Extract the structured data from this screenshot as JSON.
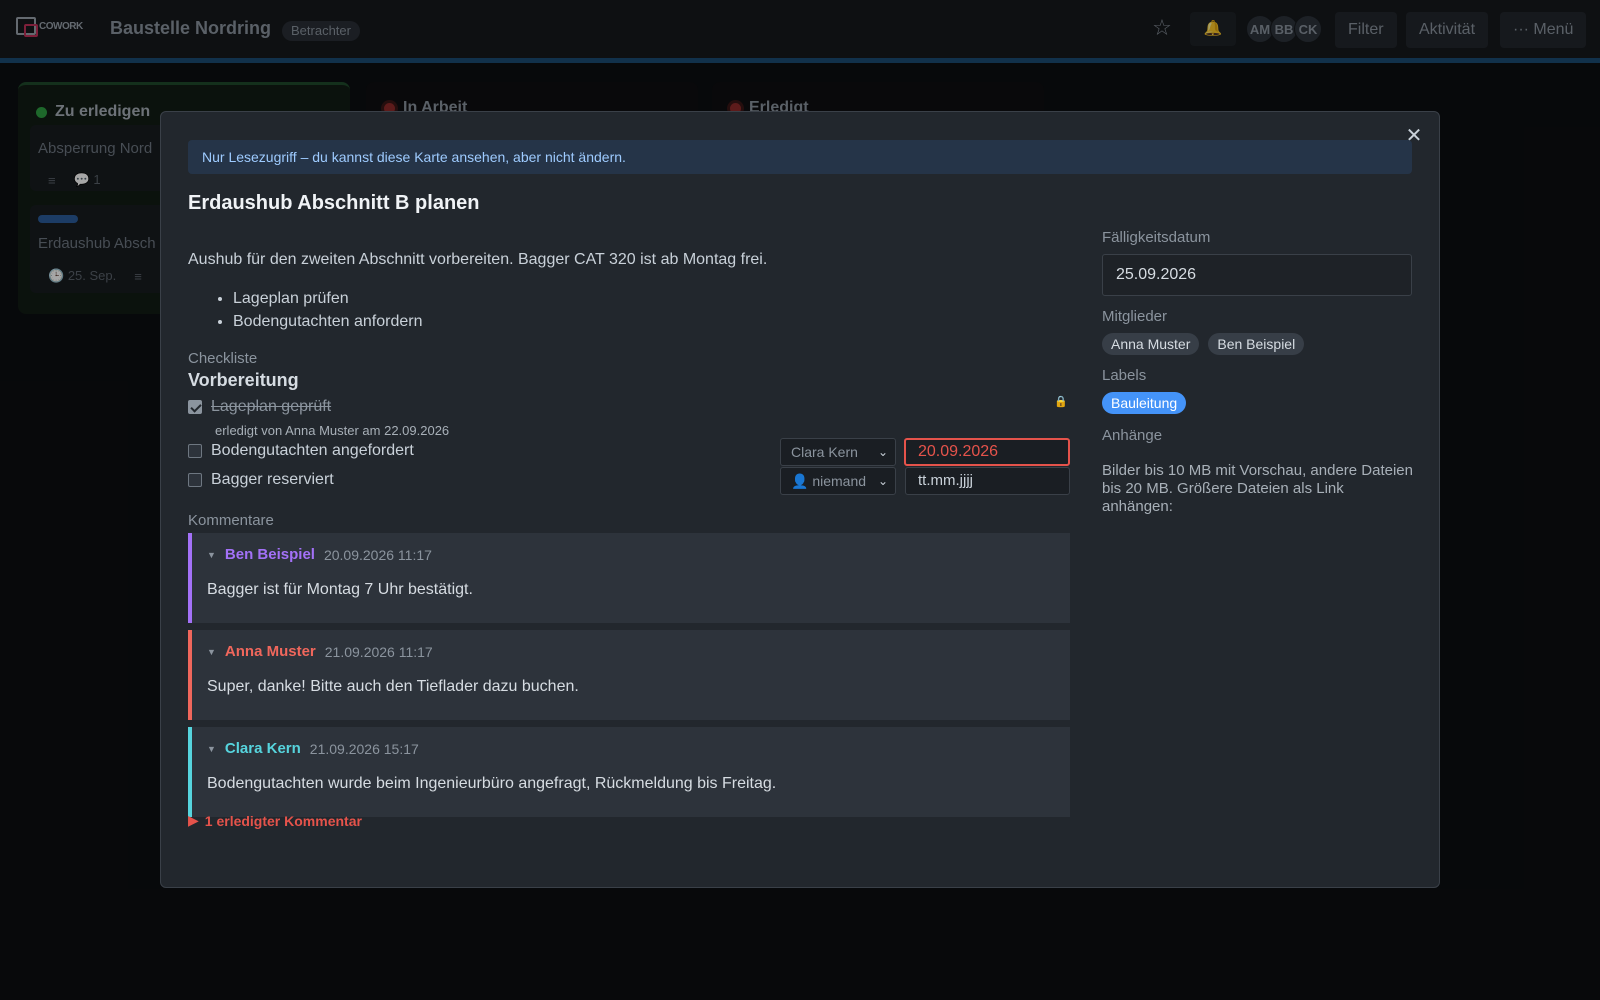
{
  "topbar": {
    "logo_text_a": "COWORK",
    "logo_text_b": "",
    "board_title": "Baustelle Nordring",
    "role_badge": "Betrachter",
    "avatars": [
      "AM",
      "BB",
      "CK"
    ],
    "filter_label": "Filter",
    "activity_label": "Aktivität",
    "menu_label": "··· Menü"
  },
  "columns": [
    {
      "title": "Zu erledigen",
      "status_color": "#2ea043"
    },
    {
      "title": "In Arbeit",
      "status_color": "#8f2a2a"
    },
    {
      "title": "Erledigt",
      "status_color": "#8f2a2a"
    }
  ],
  "mini_cards": [
    {
      "title": "Absperrung Nord",
      "comments": "1"
    },
    {
      "title": "Erdaushub Absch",
      "label_color": "#2b5d9c",
      "due": "25. Sep."
    }
  ],
  "modal": {
    "readonly_note": "Nur Lesezugriff – du kannst diese Karte ansehen, aber nicht ändern.",
    "title": "Erdaushub Abschnitt B planen",
    "description": "Aushub für den zweiten Abschnitt vorbereiten. Bagger CAT 320 ist ab Montag frei.",
    "bullets": [
      "Lageplan prüfen",
      "Bodengutachten anfordern"
    ],
    "checklist_label": "Checkliste",
    "checklist_title": "Vorbereitung",
    "checklist": [
      {
        "text": "Lageplan geprüft",
        "checked": true,
        "done_by": "erledigt von Anna Muster am 22.09.2026"
      },
      {
        "text": "Bodengutachten angefordert",
        "checked": false,
        "assignee": "Clara Kern",
        "due": "20.09.2026"
      },
      {
        "text": "Bagger reserviert",
        "checked": false,
        "assignee": "👤 niemand",
        "due": "tt.mm.jjjj"
      }
    ],
    "comments_label": "Kommentare",
    "comments": [
      {
        "author": "Ben Beispiel",
        "time": "20.09.2026 11:17",
        "text": "Bagger ist für Montag 7 Uhr bestätigt.",
        "color": "#a371f7"
      },
      {
        "author": "Anna Muster",
        "time": "21.09.2026 11:17",
        "text": "Super, danke! Bitte auch den Tieflader dazu buchen.",
        "color": "#f0675c"
      },
      {
        "author": "Clara Kern",
        "time": "21.09.2026 15:17",
        "text": "Bodengutachten wurde beim Ingenieurbüro angefragt, Rückmeldung bis Freitag.",
        "color": "#56d4dd"
      }
    ],
    "resolved_comments": "1 erledigter Kommentar"
  },
  "sidebar": {
    "due_label": "Fälligkeitsdatum",
    "due_value": "25.09.2026",
    "members_label": "Mitglieder",
    "members": [
      "Anna Muster",
      "Ben Beispiel"
    ],
    "labels_label": "Labels",
    "label": "Bauleitung",
    "label_color": "#4493f8",
    "attachments_label": "Anhänge",
    "attachments_text": "Bilder bis 10 MB mit Vorschau, andere Dateien bis 20 MB. Größere Dateien als Link anhängen:"
  }
}
